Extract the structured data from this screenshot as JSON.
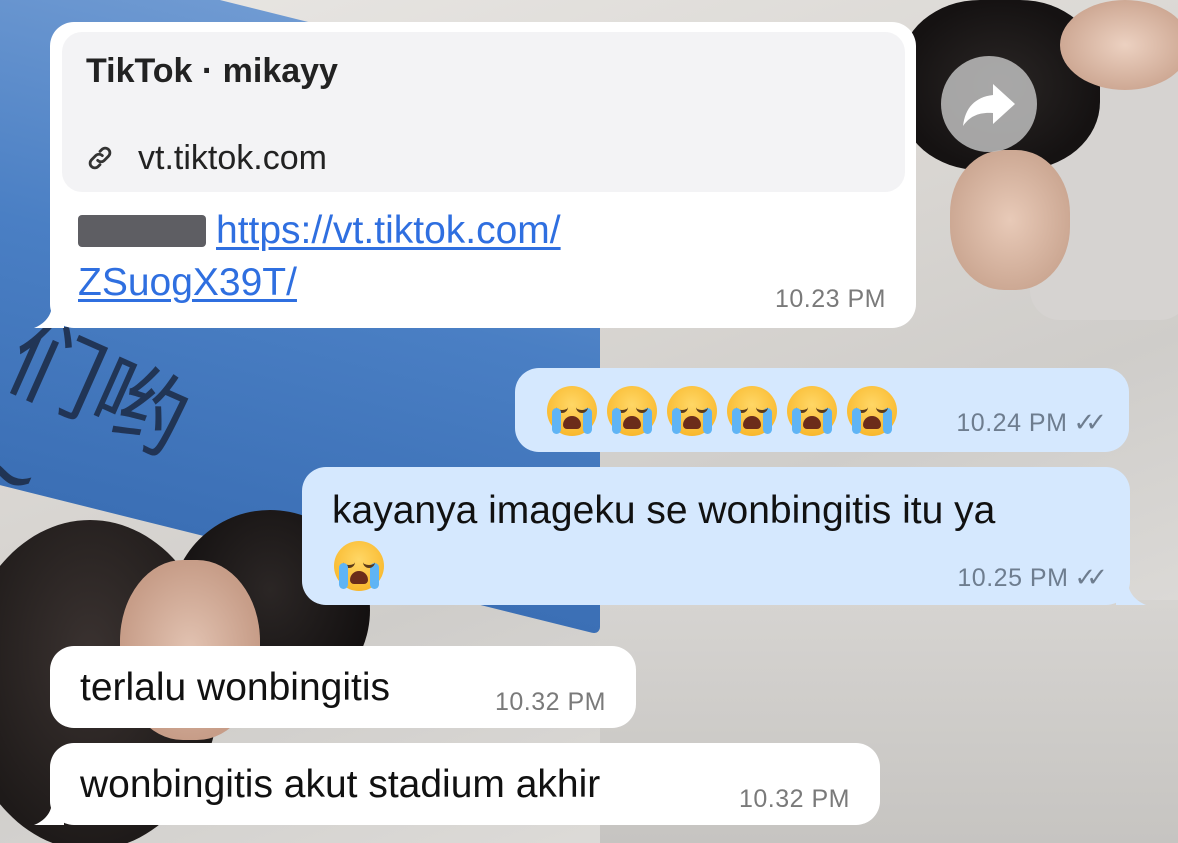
{
  "chat": {
    "link_message": {
      "card_title": "TikTok · mikayy",
      "card_domain": "vt.tiktok.com",
      "url_line1": "https://vt.tiktok.com/",
      "url_line2": "ZSuogX39T/",
      "time": "10.23 PM",
      "icons": [
        "link-icon",
        "forward-icon"
      ]
    },
    "out_emoji": {
      "emoji_count": 6,
      "emoji_name": "loudly-crying-face",
      "time": "10.24 PM",
      "status": "read"
    },
    "out_text": {
      "text": "kayanya imageku se wonbingitis itu ya",
      "trailing_emoji": "loudly-crying-face",
      "time": "10.25 PM",
      "status": "read"
    },
    "in_1": {
      "text": "terlalu wonbingitis",
      "time": "10.32 PM"
    },
    "in_2": {
      "text": "wonbingitis akut stadium akhir",
      "time": "10.32 PM"
    }
  },
  "colors": {
    "incoming_bubble": "#ffffff",
    "outgoing_bubble": "#d5e8fe",
    "link": "#2f6fe0"
  }
}
